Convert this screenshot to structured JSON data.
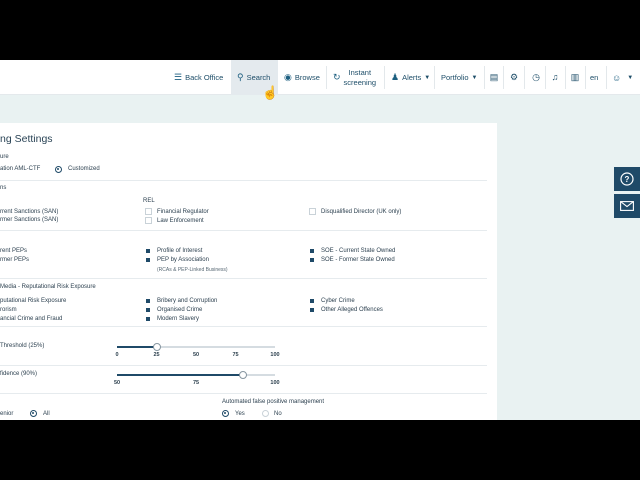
{
  "nav": {
    "back_office": "Back Office",
    "search": "Search",
    "browse": "Browse",
    "instant_screening_1": "Instant",
    "instant_screening_2": "screening",
    "alerts": "Alerts",
    "portfolio": "Portfolio",
    "language": "en",
    "icons": [
      "document-icon",
      "gear-icon",
      "clock-icon",
      "bell-icon",
      "news-icon",
      "user-icon"
    ]
  },
  "page": {
    "title": "ng Settings"
  },
  "structure": {
    "label": "ure",
    "option_1": "ation AML-CTF",
    "option_2": "Customized",
    "selected": "Customized"
  },
  "sanctions": {
    "label": "ns",
    "rel_label": "REL",
    "items_col1": [
      "rrent Sanctions (SAN)",
      "rmer Sanctions (SAN)"
    ],
    "items_col2": [
      "Financial Regulator",
      "Law Enforcement"
    ],
    "items_col3": [
      "Disqualified Director (UK only)"
    ]
  },
  "peps": {
    "items_col1": [
      "rent PEPs",
      "rmer PEPs"
    ],
    "items_col2": [
      "Profile of Interest",
      "PEP by Association"
    ],
    "note": "(RCAs & PEP-Linked Business)",
    "items_col3": [
      "SOE - Current State Owned",
      "SOE - Former State Owned"
    ]
  },
  "media": {
    "label": "Media - Reputational Risk Exposure",
    "items_col1": [
      "putational Risk Exposure",
      "rorism",
      "ancial Crime and Fraud"
    ],
    "items_col2": [
      "Bribery and Corruption",
      "Organised Crime",
      "Modern Slavery"
    ],
    "items_col3": [
      "Cyber Crime",
      "Other Alleged Offences"
    ]
  },
  "threshold": {
    "label": "Threshold (25%)",
    "value_percent": 25,
    "ticks": [
      "0",
      "25",
      "50",
      "75",
      "100"
    ]
  },
  "confidence": {
    "label": "fidence (90%)",
    "value_percent": 90,
    "min": 50,
    "ticks": [
      "50",
      "75",
      "100"
    ]
  },
  "senior": {
    "label": "enior",
    "option_all": "All"
  },
  "false_positive": {
    "label": "Automated false positive management",
    "yes": "Yes",
    "no": "No",
    "selected": "Yes"
  },
  "side": {
    "help_icon": "question-icon",
    "mail_icon": "envelope-icon"
  }
}
